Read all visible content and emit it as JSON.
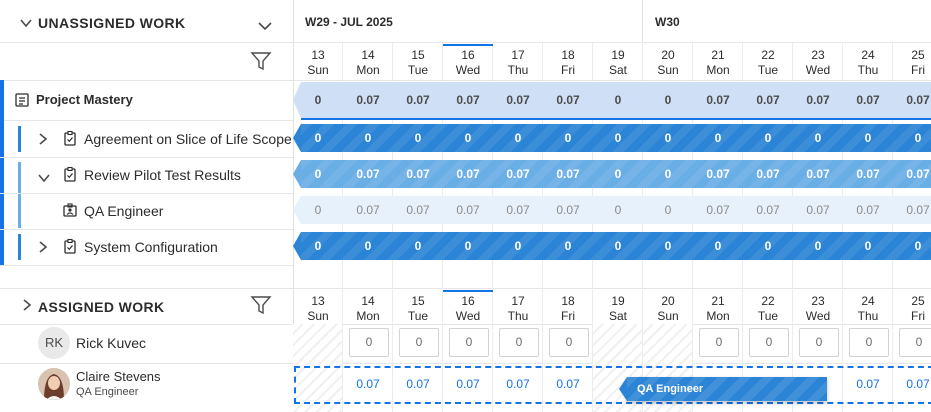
{
  "unassigned": {
    "title": "UNASSIGNED WORK",
    "rows": [
      {
        "name": "Project Mastery",
        "icon": "project-icon"
      },
      {
        "name": "Agreement on Slice of Life Scope",
        "icon": "task-icon"
      },
      {
        "name": "Review Pilot Test Results",
        "icon": "task-icon"
      },
      {
        "name": "QA Engineer",
        "icon": "role-icon"
      },
      {
        "name": "System Configuration",
        "icon": "task-icon"
      }
    ]
  },
  "assigned": {
    "title": "ASSIGNED WORK",
    "users": [
      {
        "initials": "RK",
        "name": "Rick Kuvec",
        "role": ""
      },
      {
        "initials": "",
        "name": "Claire Stevens",
        "role": "QA Engineer"
      }
    ]
  },
  "weeks": [
    {
      "label": "W29 - JUL 2025"
    },
    {
      "label": "W30"
    }
  ],
  "days": [
    {
      "num": "13",
      "dow": "Sun"
    },
    {
      "num": "14",
      "dow": "Mon"
    },
    {
      "num": "15",
      "dow": "Tue"
    },
    {
      "num": "16",
      "dow": "Wed"
    },
    {
      "num": "17",
      "dow": "Thu"
    },
    {
      "num": "18",
      "dow": "Fri"
    },
    {
      "num": "19",
      "dow": "Sat"
    },
    {
      "num": "20",
      "dow": "Sun"
    },
    {
      "num": "21",
      "dow": "Mon"
    },
    {
      "num": "22",
      "dow": "Tue"
    },
    {
      "num": "23",
      "dow": "Wed"
    },
    {
      "num": "24",
      "dow": "Thu"
    },
    {
      "num": "25",
      "dow": "Fri"
    }
  ],
  "unassigned_values": [
    [
      "0",
      "0.07",
      "0.07",
      "0.07",
      "0.07",
      "0.07",
      "0",
      "0",
      "0.07",
      "0.07",
      "0.07",
      "0.07",
      "0.07"
    ],
    [
      "0",
      "0",
      "0",
      "0",
      "0",
      "0",
      "0",
      "0",
      "0",
      "0",
      "0",
      "0",
      "0"
    ],
    [
      "0",
      "0.07",
      "0.07",
      "0.07",
      "0.07",
      "0.07",
      "0",
      "0",
      "0.07",
      "0.07",
      "0.07",
      "0.07",
      "0.07"
    ],
    [
      "0",
      "0.07",
      "0.07",
      "0.07",
      "0.07",
      "0.07",
      "0",
      "0",
      "0.07",
      "0.07",
      "0.07",
      "0.07",
      "0.07"
    ],
    [
      "0",
      "0",
      "0",
      "0",
      "0",
      "0",
      "0",
      "0",
      "0",
      "0",
      "0",
      "0",
      "0"
    ]
  ],
  "rick_values": [
    "",
    "0",
    "0",
    "0",
    "0",
    "0",
    "",
    "",
    "0",
    "0",
    "0",
    "0",
    "0"
  ],
  "claire_values": [
    "",
    "0.07",
    "0.07",
    "0.07",
    "0.07",
    "0.07",
    "",
    "",
    "",
    "",
    "",
    "0.07",
    "0.07"
  ],
  "drag_chip": "QA Engineer",
  "colors": {
    "accent": "#1473e6",
    "bar": "#2b84d6",
    "bar_light": "#6aaee6",
    "project_bg": "#cfe0f6"
  }
}
